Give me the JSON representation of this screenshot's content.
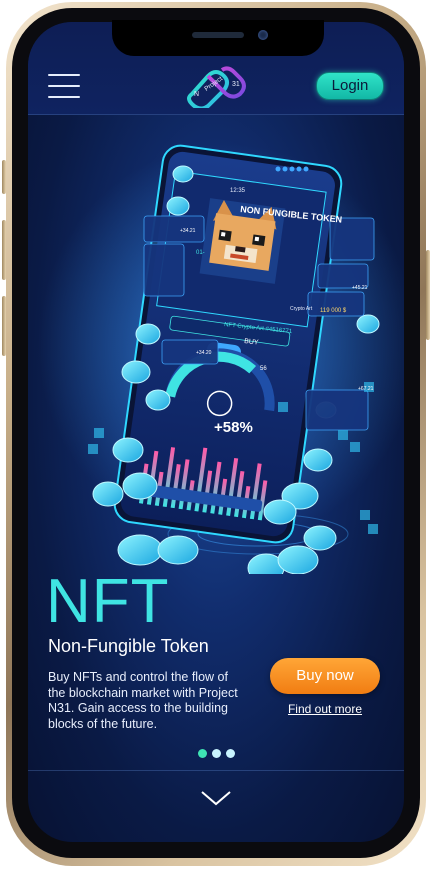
{
  "logo": {
    "top_text": "Project",
    "left_text": "N",
    "right_text": "31"
  },
  "header": {
    "login_label": "Login"
  },
  "hero_illustration": {
    "card_title": "NON FUNGIBLE TOKEN",
    "status_time": "12:35",
    "caption": "NFT Crypto Art #4516771",
    "buy_label": "BUY",
    "crypto_art_label": "Crypto Art",
    "price_value": "119 000 $",
    "gauge_percent": "+58%",
    "gauge_tag": "56",
    "side_widget_1": "+34.21",
    "side_widget_2": "+45.21",
    "side_widget_3": "+34.20",
    "side_widget_4": "+67.21",
    "label_01": "01-"
  },
  "main": {
    "title": "NFT",
    "subtitle": "Non-Fungible Token",
    "description": "Buy NFTs and control the flow of the blockchain market with Project N31. Gain access to the building blocks of the future.",
    "buy_button": "Buy now",
    "find_out_link": "Find out more"
  },
  "pagination": {
    "count": 3,
    "active_index": 0
  },
  "colors": {
    "accent_cyan": "#3fe4e3",
    "login_teal": "#30e3c8",
    "buy_orange": "#f17d12",
    "dot_active": "#3fe4b4",
    "dot_inactive": "#c8f4ff"
  },
  "icons": {
    "menu": "hamburger-menu-icon",
    "scroll_down": "chevron-down-icon"
  }
}
